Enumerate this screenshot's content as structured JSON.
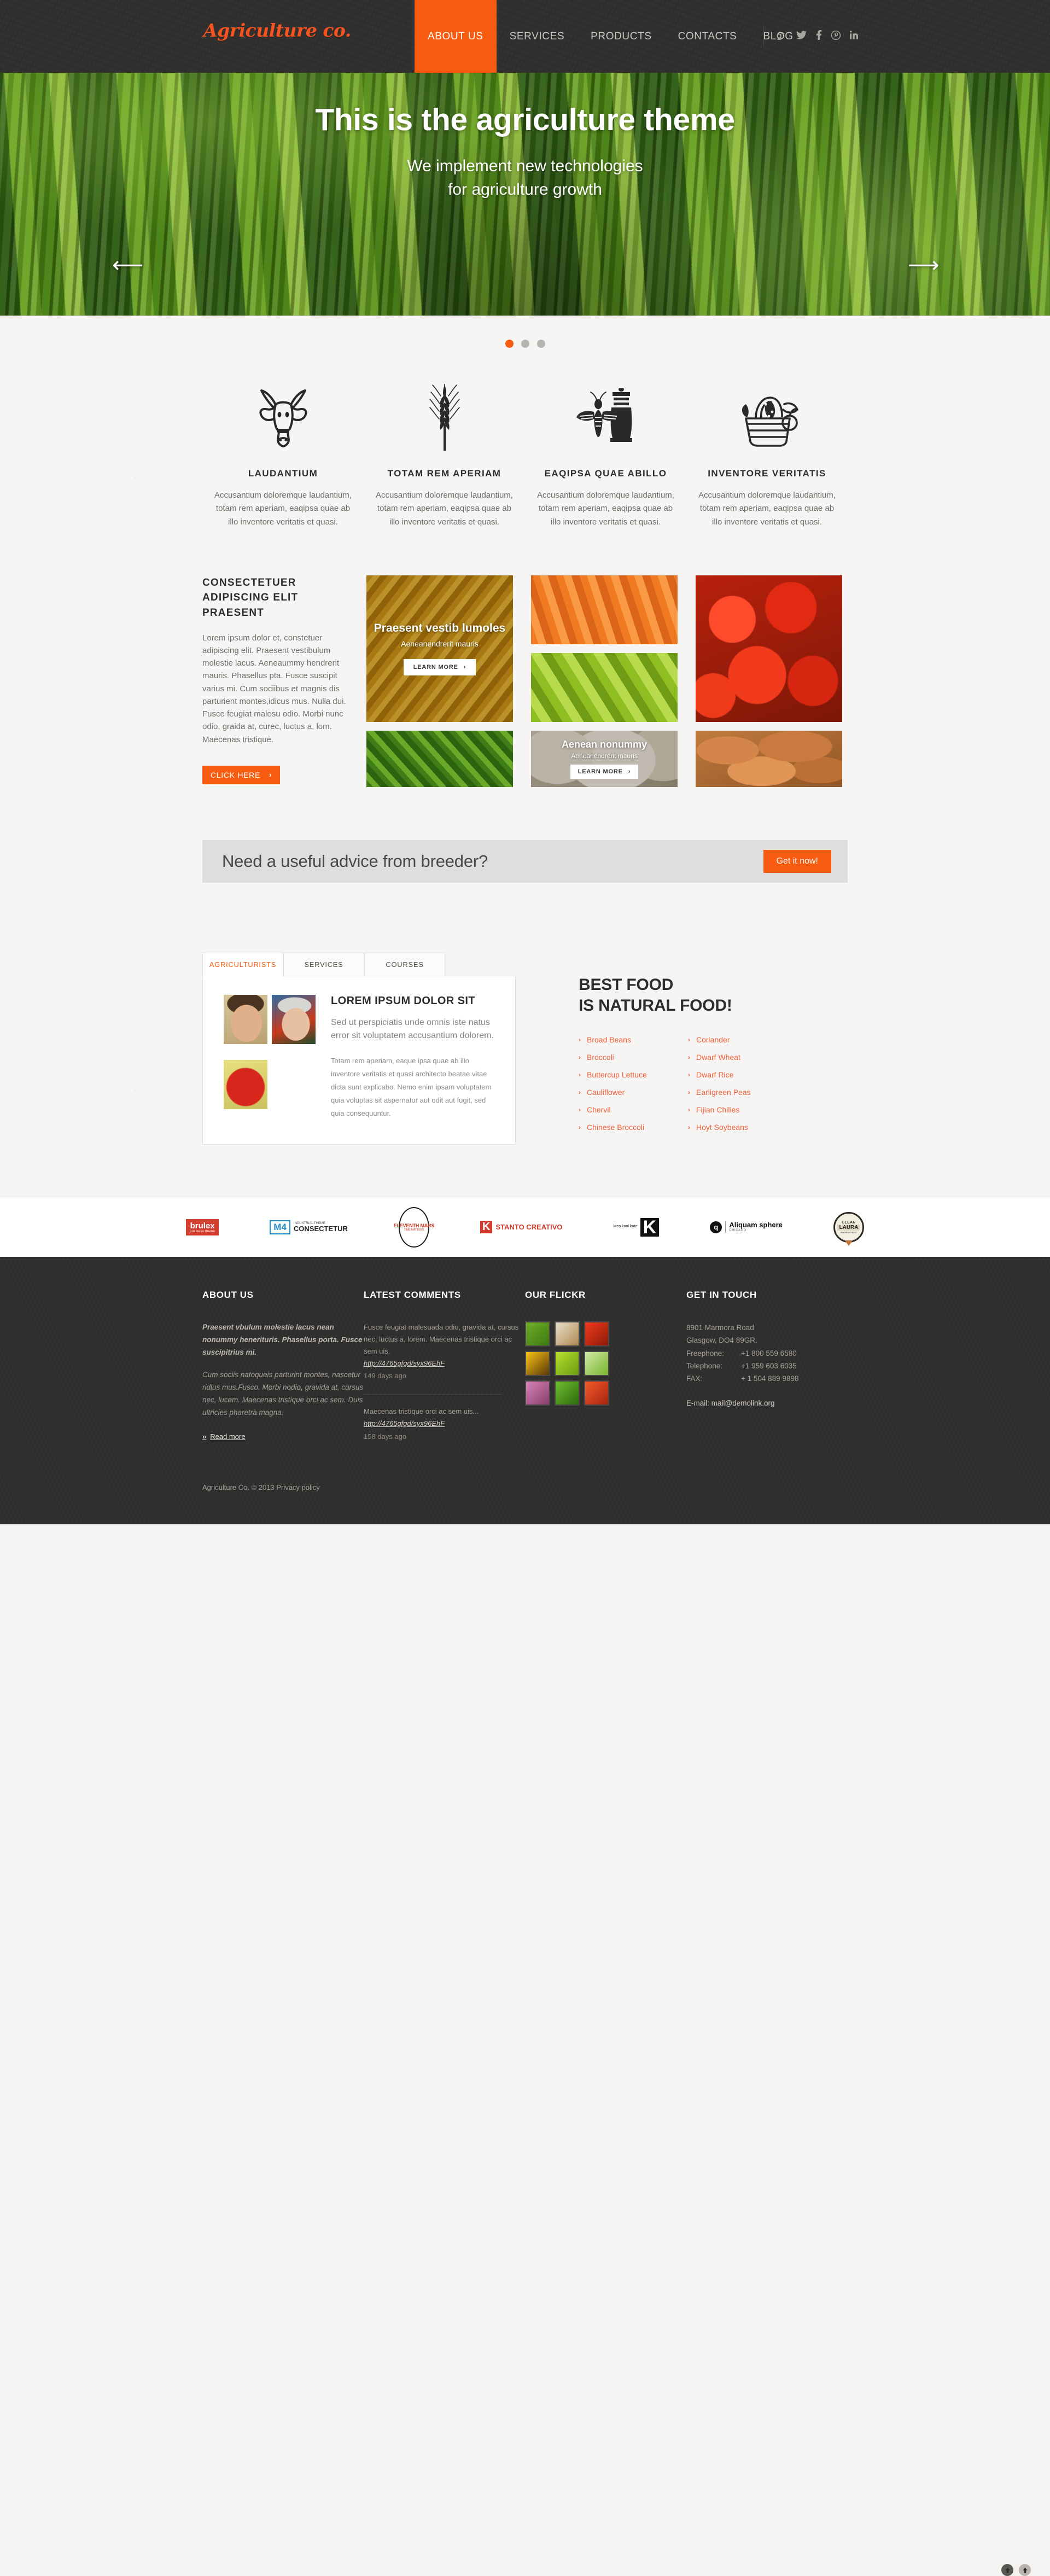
{
  "header": {
    "logo": "Agriculture co.",
    "nav": [
      {
        "label": "ABOUT US",
        "active": true
      },
      {
        "label": "SERVICES",
        "active": false
      },
      {
        "label": "PRODUCTS",
        "active": false
      },
      {
        "label": "CONTACTS",
        "active": false
      },
      {
        "label": "BLOG",
        "active": false
      }
    ],
    "social": [
      "google-plus-icon",
      "twitter-icon",
      "facebook-icon",
      "pinterest-icon",
      "linkedin-icon"
    ]
  },
  "hero": {
    "title": "This is the agriculture theme",
    "subtitle_line1": "We implement new technologies",
    "subtitle_line2": "for agriculture growth",
    "prev_icon": "arrow-left-icon",
    "next_icon": "arrow-right-icon",
    "dots": 3,
    "active_dot": 0
  },
  "features": [
    {
      "icon": "cow-head-icon",
      "title": "LAUDANTIUM",
      "text": "Accusantium doloremque laudantium, totam rem aperiam, eaqipsa quae ab illo inventore veritatis et quasi."
    },
    {
      "icon": "wheat-ear-icon",
      "title": "TOTAM REM APERIAM",
      "text": "Accusantium doloremque laudantium, totam rem aperiam, eaqipsa quae ab illo inventore veritatis et quasi."
    },
    {
      "icon": "bee-and-jar-icon",
      "title": "EAQIPSA QUAE ABILLO",
      "text": "Accusantium doloremque laudantium, totam rem aperiam, eaqipsa quae ab illo inventore veritatis et quasi."
    },
    {
      "icon": "fruit-basket-icon",
      "title": "INVENTORE VERITATIS",
      "text": "Accusantium doloremque laudantium, totam rem aperiam, eaqipsa quae ab illo inventore veritatis et quasi."
    }
  ],
  "gallery": {
    "heading": "CONSECTETUER ADIPISCING ELIT PRAESENT",
    "paragraph": "Lorem ipsum dolor et, constetuer adipiscing elit. Praesent vestibulum molestie lacus. Aeneaummy hendrerit mauris. Phasellus pta. Fusce suscipit varius mi. Cum sociibus et magnis dis parturient montes,idicus mus. Nulla dui. Fusce feugiat malesu odio. Morbi nunc odio, graida at, curec, luctus a, lom. Maecenas tristique.",
    "click_here": "CLICK HERE",
    "chevron": "›",
    "tiles": [
      {
        "id": "corn",
        "title": "Praesent vestib lumoles",
        "subtitle": "Aeneanendrerit mauris",
        "button": "LEARN MORE"
      },
      {
        "id": "carrot",
        "title": "",
        "subtitle": "",
        "button": ""
      },
      {
        "id": "pepper",
        "title": "",
        "subtitle": "",
        "button": ""
      },
      {
        "id": "tomato",
        "title": "",
        "subtitle": "",
        "button": ""
      },
      {
        "id": "lettuce",
        "title": "",
        "subtitle": "",
        "button": ""
      },
      {
        "id": "garlic",
        "title": "Aenean nonummy",
        "subtitle": "Aeneanendrerit mauris",
        "button": "LEARN MORE"
      },
      {
        "id": "potato",
        "title": "",
        "subtitle": "",
        "button": ""
      }
    ]
  },
  "cta": {
    "text": "Need a useful advice from breeder?",
    "button": "Get it now!"
  },
  "tabs": {
    "items": [
      {
        "label": "AGRICULTURISTS",
        "active": true
      },
      {
        "label": "SERVICES",
        "active": false
      },
      {
        "label": "COURSES",
        "active": false
      }
    ],
    "panel": {
      "heading": "LOREM IPSUM DOLOR SIT",
      "lead": "Sed ut perspiciatis unde omnis iste natus error sit voluptatem accusantium dolorem.",
      "body": "Totam rem aperiam, eaque ipsa quae ab illo inventore veritatis et quasi architecto beatae vitae dicta sunt explicabo. Nemo enim ipsam voluptatem quia voluptas sit aspernatur aut odit aut fugit, sed quia consequuntur.",
      "thumbs": [
        "farmer-portrait-1",
        "farmer-portrait-2",
        "apple-in-hands"
      ]
    }
  },
  "bestfood": {
    "heading_line1": "BEST FOOD",
    "heading_line2": "IS NATURAL FOOD!",
    "chevron": "›",
    "col1": [
      "Broad Beans",
      "Broccoli",
      "Buttercup Lettuce",
      "Cauliflower",
      "Chervil",
      "Chinese Broccoli"
    ],
    "col2": [
      "Coriander",
      "Dwarf Wheat",
      "Dwarf Rice",
      "Earligreen Peas",
      "Fijian Chilies",
      "Hoyt Soybeans"
    ]
  },
  "partners": [
    {
      "id": "brulex-logo",
      "name": "brulex",
      "tagline": "business theme"
    },
    {
      "id": "m4-consectetur-logo",
      "mark": "M4",
      "name": "CONSECTETUR",
      "tagline": "INDUSTRIAL THEME"
    },
    {
      "id": "eleventh-mars-logo",
      "name": "ELEVENTH MARS",
      "tagline": "TIME MATTERS"
    },
    {
      "id": "stanto-creativo-logo",
      "mark": "K",
      "name": "STANTO CREATIVO"
    },
    {
      "id": "kreo-kool-katz-logo",
      "name": "kreo kool katz",
      "mark": "K"
    },
    {
      "id": "aliquam-sphere-logo",
      "mark": "q",
      "name": "Aliquam sphere",
      "tagline": "CHICAGO"
    },
    {
      "id": "clean-laura-logo",
      "name": "CLEAN LAURA",
      "tagline": "PREMIUM BEST"
    }
  ],
  "footer": {
    "about": {
      "title": "ABOUT US",
      "p1": "Praesent vbulum molestie lacus nean nonummy henerituris. Phasellus porta. Fusce suscipitrius mi.",
      "p2": "Cum sociis natoqueis parturint montes, nascetur ridlus mus.Fusco. Morbi nodio, gravida at, cursus nec, lucem. Maecenas tristique orci ac sem. Duis ultricies pharetra magna.",
      "read_more": "Read more",
      "read_more_icon": "double-chevron-right-icon"
    },
    "comments": {
      "title": "LATEST COMMENTS",
      "items": [
        {
          "text": "Fusce feugiat malesuada odio, gravida at, cursus nec, luctus a, lorem. Maecenas tristique orci ac sem uis.",
          "url": "http://4765gfgd/syx96EhF",
          "ago": "149 days ago"
        },
        {
          "text": "Maecenas tristique orci ac sem uis...",
          "url": "http://4765gfgd/syx96EhF",
          "ago": "158 days ago"
        }
      ]
    },
    "flickr": {
      "title": "OUR FLICKR",
      "photos": [
        "dew-on-leaf",
        "bread-and-milk",
        "red-apple-on-tree",
        "sunflower",
        "green-apples",
        "green-peas-in-bowl",
        "purple-flower",
        "cucumbers",
        "tomatoes"
      ]
    },
    "touch": {
      "title": "GET IN TOUCH",
      "address1": "8901 Marmora Road",
      "address2": "Glasgow, DO4 89GR.",
      "freephone_label": "Freephone:",
      "freephone": "+1 800 559 6580",
      "telephone_label": "Telephone:",
      "telephone": "+1 959 603 6035",
      "fax_label": "FAX:",
      "fax": "+ 1 504 889 9898",
      "email_label": "E-mail:",
      "email": "mail@demolink.org"
    },
    "copyright": "Agriculture Co. © 2013 Privacy policy",
    "scroll_buttons": [
      "scroll-up-icon-dim",
      "scroll-up-icon-bright"
    ]
  },
  "colors": {
    "accent": "#f75c10",
    "dark": "#312f2d",
    "page_bg": "#f6f5f3",
    "cta_bg": "#dfdedc"
  }
}
